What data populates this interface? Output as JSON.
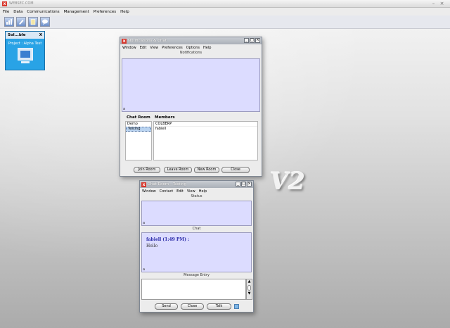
{
  "app": {
    "title": "WEBSEC.COM",
    "menu": [
      "File",
      "Data",
      "Communications",
      "Management",
      "Preferences",
      "Help"
    ]
  },
  "toolbar": {
    "icons": [
      "chart-icon",
      "pen-icon",
      "clipboard-icon",
      "chat-bubble-icon"
    ]
  },
  "side_panel": {
    "title": "Sol...ble",
    "close": "X",
    "project": "Project : Alpha Test"
  },
  "watermark": "V2",
  "notifications_window": {
    "title": "Notifications & Chat",
    "menu": [
      "Window",
      "Edit",
      "View",
      "Preferences",
      "Options",
      "Help"
    ],
    "notifications_label": "Notifications",
    "corner_marker": "a",
    "chat_room_header": "Chat Room",
    "members_header": "Members",
    "rooms": [
      {
        "name": "Demo",
        "selected": false
      },
      {
        "name": "Testing",
        "selected": true
      }
    ],
    "members": [
      "COLBERP",
      "fabiell"
    ],
    "buttons": {
      "join": "Join Room",
      "leave": "Leave Room",
      "new": "New Room",
      "close": "Close"
    }
  },
  "chat_window": {
    "title": "Chat Room - Testing",
    "menu": [
      "Window",
      "Contact",
      "Edit",
      "View",
      "Help"
    ],
    "status_label": "Status",
    "chat_label": "Chat",
    "message_entry_label": "Message Entry",
    "corner_marker": "a",
    "messages": [
      {
        "sender": "fabiell",
        "time": "(1:49 PM) :",
        "text": "Hello"
      }
    ],
    "buttons": {
      "send": "Send",
      "close": "Close",
      "talk": "Talk"
    }
  },
  "colors": {
    "panel_blue": "#29a3e6",
    "chat_pane": "#dcdcff",
    "logo_red": "#d8372c"
  }
}
